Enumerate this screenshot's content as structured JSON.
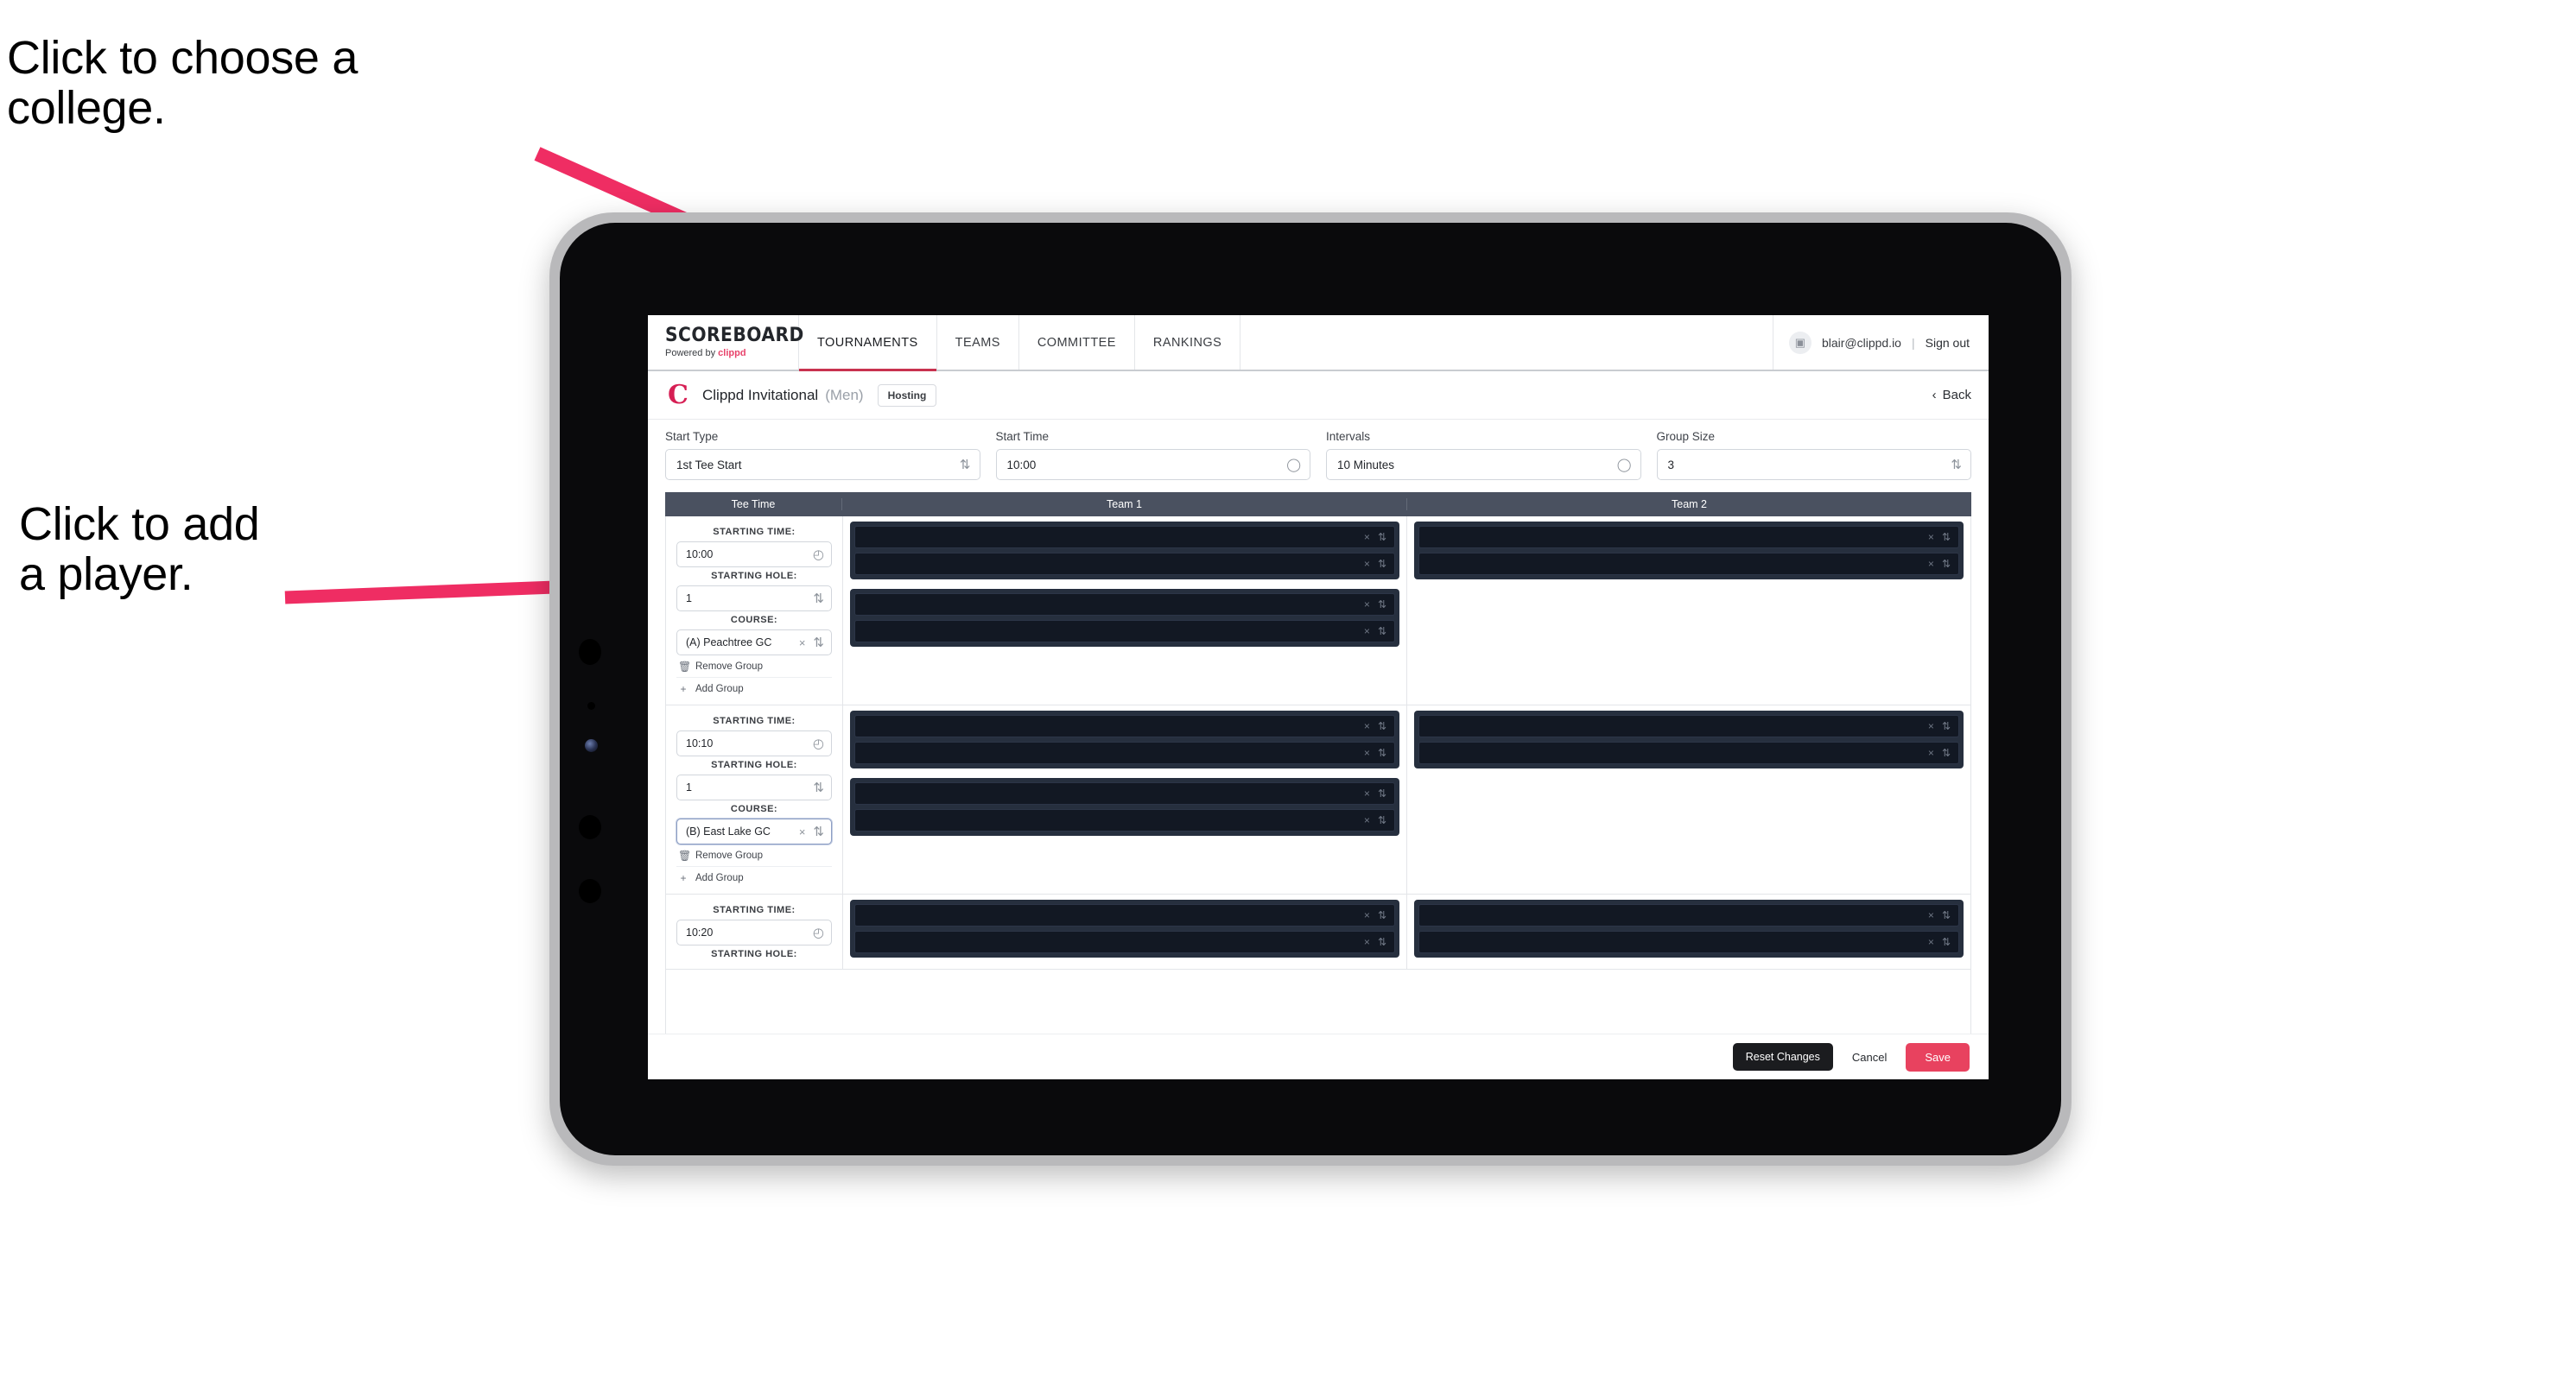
{
  "annotations": {
    "choose_college": "Click to choose a\ncollege.",
    "add_player": "Click to add\na player."
  },
  "colors": {
    "accent_pink": "#e8425f",
    "arrow_pink": "#ef2d63",
    "nav_underline": "#c8324f",
    "table_header": "#4a5160",
    "player_group_bg": "#262f3e",
    "player_row_bg": "#121823"
  },
  "navbar": {
    "brand_title": "SCOREBOARD",
    "brand_sub_prefix": "Powered by ",
    "brand_sub_brand": "clippd",
    "tabs": [
      {
        "label": "TOURNAMENTS",
        "active": true
      },
      {
        "label": "TEAMS",
        "active": false
      },
      {
        "label": "COMMITTEE",
        "active": false
      },
      {
        "label": "RANKINGS",
        "active": false
      }
    ],
    "avatar_icon": "user-icon",
    "user_email": "blair@clippd.io",
    "separator": "|",
    "sign_out": "Sign out"
  },
  "tournament_bar": {
    "logo_letter": "C",
    "name": "Clippd Invitational",
    "gender": "(Men)",
    "badge": "Hosting",
    "back_label": "Back",
    "back_icon": "chevron-left-icon"
  },
  "controls": [
    {
      "label": "Start Type",
      "value": "1st Tee Start",
      "trailing_icon": "spinner-icon"
    },
    {
      "label": "Start Time",
      "value": "10:00",
      "trailing_icon": "clock-icon"
    },
    {
      "label": "Intervals",
      "value": "10 Minutes",
      "trailing_icon": "clock-icon"
    },
    {
      "label": "Group Size",
      "value": "3",
      "trailing_icon": "spinner-icon"
    }
  ],
  "table": {
    "headers": [
      "Tee Time",
      "Team 1",
      "Team 2"
    ],
    "labels": {
      "starting_time": "STARTING TIME:",
      "starting_hole": "STARTING HOLE:",
      "course": "COURSE:",
      "remove_group": "Remove Group",
      "add_group": "Add Group",
      "remove_icon": "trash-icon",
      "add_icon": "plus-icon",
      "clear_icon": "close-x-icon",
      "spinner_icon": "spinner-icon",
      "clock_icon": "clock-icon"
    },
    "rows": [
      {
        "starting_time": "10:00",
        "starting_hole": "1",
        "course": "(A) Peachtree GC",
        "course_focused": false,
        "team1_groups": [
          {
            "players": [
              "",
              ""
            ]
          },
          {
            "players": [
              "",
              ""
            ]
          }
        ],
        "team2_groups": [
          {
            "players": [
              "",
              ""
            ]
          }
        ]
      },
      {
        "starting_time": "10:10",
        "starting_hole": "1",
        "course": "(B) East Lake GC",
        "course_focused": true,
        "team1_groups": [
          {
            "players": [
              "",
              ""
            ]
          },
          {
            "players": [
              "",
              ""
            ]
          }
        ],
        "team2_groups": [
          {
            "players": [
              "",
              ""
            ]
          }
        ]
      },
      {
        "starting_time": "10:20",
        "starting_hole": "",
        "course": "",
        "course_focused": false,
        "team1_groups": [
          {
            "players": [
              "",
              ""
            ]
          }
        ],
        "team2_groups": [
          {
            "players": [
              "",
              ""
            ]
          }
        ]
      }
    ]
  },
  "footer": {
    "reset": "Reset Changes",
    "cancel": "Cancel",
    "save": "Save"
  }
}
